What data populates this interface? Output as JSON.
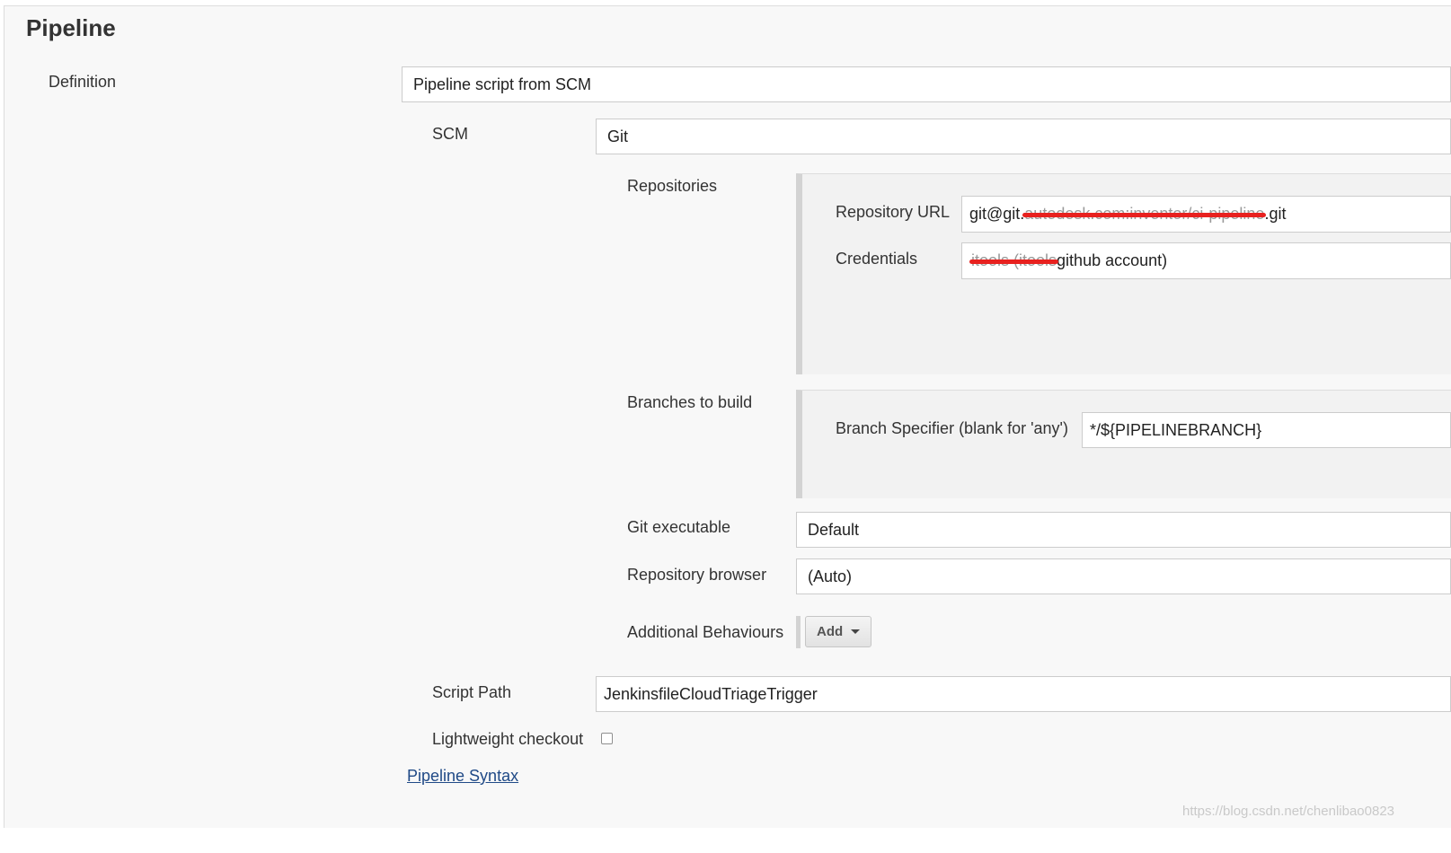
{
  "section": {
    "title": "Pipeline"
  },
  "definition": {
    "label": "Definition",
    "value": "Pipeline script from SCM"
  },
  "scm": {
    "label": "SCM",
    "value": "Git"
  },
  "repositories": {
    "label": "Repositories",
    "url_label": "Repository URL",
    "url_prefix": "git@git.",
    "url_redacted": "autodesk.com:inventor/ci-pipeline",
    "url_suffix": ".git",
    "credentials_label": "Credentials",
    "credentials_redacted": "itools (itools",
    "credentials_suffix": " github account)"
  },
  "branches": {
    "label": "Branches to build",
    "specifier_label": "Branch Specifier (blank for 'any')",
    "specifier_value": "*/${PIPELINEBRANCH}"
  },
  "git_executable": {
    "label": "Git executable",
    "value": "Default"
  },
  "repository_browser": {
    "label": "Repository browser",
    "value": "(Auto)"
  },
  "additional_behaviours": {
    "label": "Additional Behaviours",
    "add_label": "Add"
  },
  "script_path": {
    "label": "Script Path",
    "value": "JenkinsfileCloudTriageTrigger"
  },
  "lightweight_checkout": {
    "label": "Lightweight checkout",
    "checked": false
  },
  "pipeline_syntax_link": "Pipeline Syntax",
  "watermark": "https://blog.csdn.net/chenlibao0823",
  "icons": {
    "dropdown": "caret-down-icon",
    "checkbox": "checkbox-icon"
  },
  "colors": {
    "link": "#204a87",
    "redaction": "#e8211f"
  }
}
